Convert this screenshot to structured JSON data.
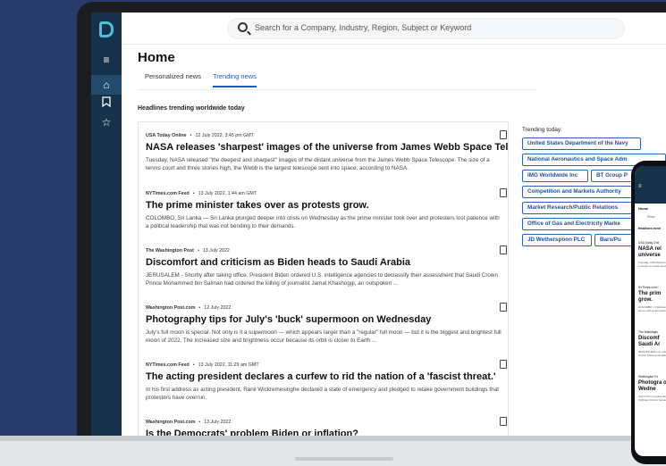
{
  "search": {
    "placeholder": "Search for a Company, Industry, Region, Subject or Keyword"
  },
  "page": {
    "title": "Home",
    "subtitle": "Headlines trending worldwide today"
  },
  "tabs": [
    {
      "label": "Personalized news"
    },
    {
      "label": "Trending news"
    }
  ],
  "sidebar": {
    "icons": [
      "menu-icon",
      "home-icon",
      "bookmark-icon",
      "star-icon"
    ]
  },
  "articles": [
    {
      "source": "USA Today Online",
      "date": "12 July 2022, 3:45 pm GMT",
      "headline": "NASA releases 'sharpest' images of the universe from James Webb Space Telescope",
      "snippet": "Tuesday, NASA released \"the deepest and sharpest\" images of the distant universe from the James Webb Space Telescope. The size of a tennis court and three stories high, the Webb is the largest telescope sent into space, according to NASA."
    },
    {
      "source": "NYTimes.com Feed",
      "date": "13 July 2022, 1:44 am GMT",
      "headline": "The prime minister takes over as protests grow.",
      "snippet": "COLOMBO, Sri Lanka — Sri Lanka plunged deeper into crisis on Wednesday as the prime minister took over and protesters lost patience with a political leadership that was not bending to their demands."
    },
    {
      "source": "The Washington Post",
      "date": "13 July 2022",
      "headline": "Discomfort and criticism as Biden heads to Saudi Arabia",
      "snippet": "JERUSALEM - Shortly after taking office, President Biden ordered U.S. intelligence agencies to declassify their assessment that Saudi Crown Prince Mohammed bin Salman had ordered the killing of journalist Jamal Khashoggi, an outspoken ..."
    },
    {
      "source": "Washington Post.com",
      "date": "12 July 2022",
      "headline": "Photography tips for July's 'buck' supermoon on Wednesday",
      "snippet": "July's full moon is special. Not only is it a supermoon — which appears larger than a \"regular\" full moon — but it is the biggest and brightest full moon of 2022. The increased size and brightness occur because its orbit is closer to Earth ..."
    },
    {
      "source": "NYTimes.com Feed",
      "date": "13 July 2022, 11:29 am GMT",
      "headline": "The acting president declares a curfew to rid the nation of a 'fascist threat.'",
      "snippet": "In his first address as acting president, Ranil Wickremesinghe declared a state of emergency and pledged to retake government buildings that protesters have overrun."
    },
    {
      "source": "Washington Post.com",
      "date": "13 July 2022",
      "headline": "Is the Democrats' problem Biden or inflation?",
      "snippet": ""
    }
  ],
  "trending": {
    "title": "Trending today:",
    "chips": [
      "United States Department of the Navy",
      "National Aeronautics and Space Adm",
      "IMG Worldwide Inc",
      "BT Group P",
      "Competition and Markets Authority",
      "Market Research/Public Relations",
      "Office of Gas and Electricity Marke",
      "JD Wetherspoon PLC",
      "Bars/Pu"
    ]
  },
  "phone": {
    "page_title": "Home",
    "tab": "Perso",
    "subhead": "Headlines trend",
    "a1_source": "USA Today Onli",
    "a1_headline": "NASA rel universe",
    "a1_snippet": "Tuesday, NAS distant unive of a tennis co scope sent in",
    "a2_source": "NYTimes.com f",
    "a2_headline": "The prim grow.",
    "a2_snippet": "COLOMBO, S Wednesday a tience with a demands.",
    "a3_source": "The Washingto",
    "a3_headline": "Discomf Saudi Ar",
    "a3_snippet": "JERUSALEM U.S. intellige Crown Prince journalist Ja",
    "a4_source": "Washington Po",
    "a4_headline": "Photogra on Wedne",
    "a4_snippet": "July's full mo pears larger t brightest full our because i"
  }
}
